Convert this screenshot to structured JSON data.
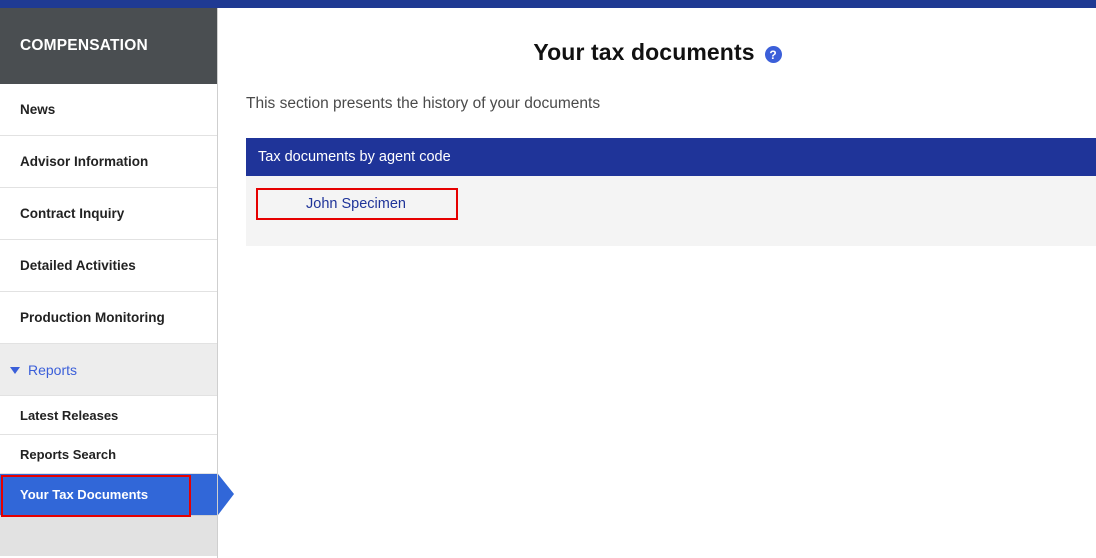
{
  "colors": {
    "topbar": "#1f3a93",
    "sidebar_header_bg": "#4a4e51",
    "active_item_bg": "#3167d8",
    "panel_header_bg": "#1f3499",
    "highlight_red": "#e60000",
    "link_blue": "#1f3499",
    "section_blue": "#3b5fd9"
  },
  "sidebar": {
    "header_title": "COMPENSATION",
    "items": [
      {
        "label": "News",
        "type": "item",
        "active": false
      },
      {
        "label": "Advisor Information",
        "type": "item",
        "active": false
      },
      {
        "label": "Contract Inquiry",
        "type": "item",
        "active": false
      },
      {
        "label": "Detailed Activities",
        "type": "item",
        "active": false
      },
      {
        "label": "Production Monitoring",
        "type": "item",
        "active": false
      },
      {
        "label": "Reports",
        "type": "section",
        "active": false,
        "icon": "chevron-down-icon",
        "expanded": true
      },
      {
        "label": "Latest Releases",
        "type": "sub",
        "active": false
      },
      {
        "label": "Reports Search",
        "type": "sub",
        "active": false
      },
      {
        "label": "Your Tax Documents",
        "type": "sub",
        "active": true
      }
    ]
  },
  "main": {
    "title": "Your tax documents",
    "help_icon": "help-circle-icon",
    "help_glyph": "?",
    "intro": "This section presents the history of your documents",
    "panel": {
      "header": "Tax documents by agent code",
      "agent_link": "John Specimen"
    }
  }
}
